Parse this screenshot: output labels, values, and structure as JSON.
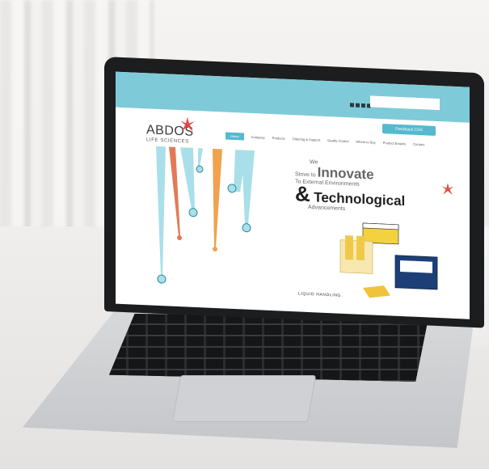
{
  "screen": {
    "brand_name": "ABDOS",
    "brand_sub": "LIFE SCIENCES",
    "cta_button": "Feedback CSS",
    "nav_items": [
      "Home",
      "Company",
      "Products",
      "Ordering & Support",
      "Quality Control",
      "Where to Buy",
      "Product Enquiry",
      "Contact"
    ],
    "hero_line1": "We",
    "hero_line2": "Strive to",
    "hero_big1": "Innovate",
    "hero_line3": "To External Environments",
    "hero_amp": "&",
    "hero_big2": "Technological",
    "hero_line4": "Advancements",
    "caption": "LIQUID HANDLING"
  },
  "colors": {
    "topbar": "#7fcad8",
    "accent": "#55b9cf",
    "logo_red": "#e04a45"
  }
}
